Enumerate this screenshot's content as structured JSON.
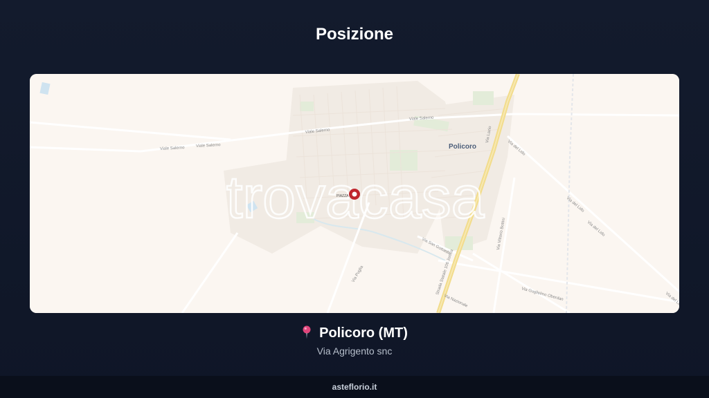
{
  "header": {
    "title": "Posizione"
  },
  "map": {
    "watermark": "trovacasa",
    "town_label": "Policoro",
    "marker_label": "PIAZZA ... ",
    "road_labels": {
      "viale_salerno": "Viale Salerno",
      "ss106": "Strada Statale 106 Jonica",
      "via_lido": "Via del Lido",
      "via_san_gottardo": "Via San Gottardo",
      "via_puglia": "Via Puglia",
      "via_nazionale": "Via Nazionale",
      "via_guglielmo": "Via Guglielmo Oberdan",
      "via_vittorio": "Via Vittorio Bottini",
      "via_lazio": "Via Lazio"
    },
    "colors": {
      "background": "#fbf6f1",
      "marker": "#c0262d",
      "highway": "#f2dc8c"
    }
  },
  "location": {
    "pin_icon": "round-pushpin-icon",
    "city": "Policoro (MT)",
    "address": "Via Agrigento snc"
  },
  "footer": {
    "site": "asteflorio.it"
  }
}
